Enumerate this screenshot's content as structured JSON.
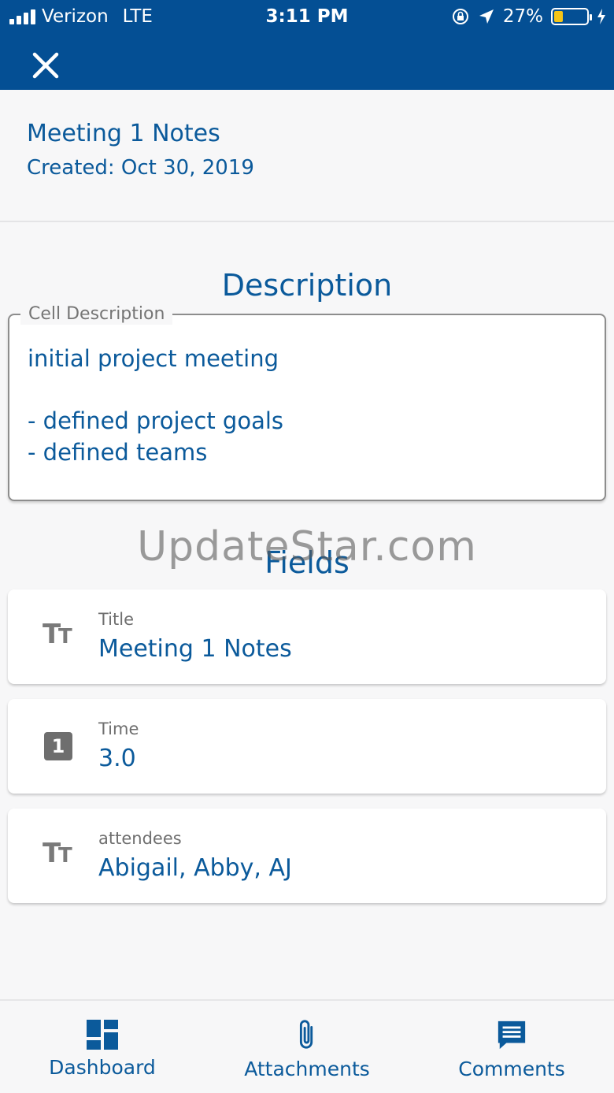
{
  "status_bar": {
    "carrier": "Verizon",
    "network": "LTE",
    "time": "3:11 PM",
    "battery_percent": "27%",
    "battery_level": 0.27,
    "icons": [
      "signal-icon",
      "orientation-lock-icon",
      "location-icon",
      "battery-icon",
      "charging-icon"
    ]
  },
  "toolbar": {
    "close_icon": "close-icon"
  },
  "header": {
    "title": "Meeting 1 Notes",
    "created": "Created: Oct 30, 2019"
  },
  "description": {
    "heading": "Description",
    "field_label": "Cell Description",
    "lines": [
      "initial project meeting",
      "",
      "- defined project goals",
      "- defined teams"
    ]
  },
  "watermark": "UpdateStar.com",
  "fields": {
    "heading": "Fields",
    "items": [
      {
        "label": "Title",
        "value": "Meeting 1 Notes",
        "icon": "text-type-icon"
      },
      {
        "label": "Time",
        "value": "3.0",
        "icon": "number-type-icon",
        "icon_text": "1"
      },
      {
        "label": "attendees",
        "value": "Abigail, Abby, AJ",
        "icon": "text-type-icon"
      }
    ]
  },
  "bottom_nav": {
    "items": [
      {
        "label": "Dashboard",
        "icon": "dashboard-icon"
      },
      {
        "label": "Attachments",
        "icon": "paperclip-icon"
      },
      {
        "label": "Comments",
        "icon": "comment-icon"
      }
    ]
  },
  "colors": {
    "primary": "#044f94",
    "text_blue": "#0b5a9b",
    "battery": "#f5c518",
    "icon_grey": "#7a7a7a"
  }
}
